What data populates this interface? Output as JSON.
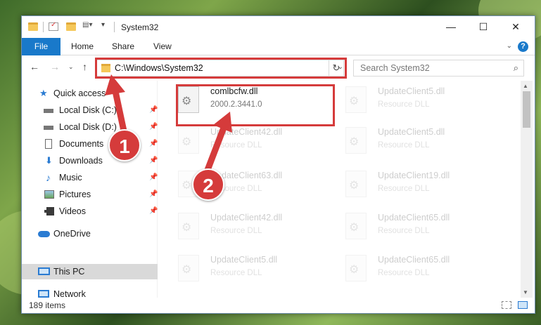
{
  "window": {
    "title": "System32",
    "controls": {
      "minimize": "—",
      "maximize": "☐",
      "close": "✕"
    }
  },
  "ribbon": {
    "file_tab": "File",
    "tabs": [
      "Home",
      "Share",
      "View"
    ],
    "help": "?"
  },
  "address": {
    "path": "C:\\Windows\\System32",
    "search_placeholder": "Search System32"
  },
  "nav": {
    "items": [
      {
        "label": "Quick access",
        "icon": "star-icon",
        "pinned": false
      },
      {
        "label": "Local Disk (C:)",
        "icon": "drive-icon",
        "pinned": true
      },
      {
        "label": "Local Disk (D:)",
        "icon": "drive-icon",
        "pinned": true
      },
      {
        "label": "Documents",
        "icon": "documents-icon",
        "pinned": true
      },
      {
        "label": "Downloads",
        "icon": "download-icon",
        "pinned": true
      },
      {
        "label": "Music",
        "icon": "music-icon",
        "pinned": true
      },
      {
        "label": "Pictures",
        "icon": "pictures-icon",
        "pinned": true
      },
      {
        "label": "Videos",
        "icon": "videos-icon",
        "pinned": true
      },
      {
        "label": "OneDrive",
        "icon": "cloud-icon",
        "pinned": false
      },
      {
        "label": "This PC",
        "icon": "computer-icon",
        "pinned": false,
        "selected": true
      },
      {
        "label": "Network",
        "icon": "network-icon",
        "pinned": false
      }
    ]
  },
  "files": {
    "highlighted": {
      "name": "comlbcfw.dll",
      "version": "2000.2.3441.0"
    },
    "background_col1": [
      {
        "name": "UpdateClient42.dll",
        "type": "Resource DLL"
      },
      {
        "name": "UpdateClient63.dll",
        "type": "Resource DLL"
      },
      {
        "name": "UpdateClient42.dll",
        "type": "Resource DLL"
      },
      {
        "name": "UpdateClient5.dll",
        "type": "Resource DLL"
      }
    ],
    "background_col2": [
      {
        "name": "UpdateClient5.dll",
        "type": "Resource DLL"
      },
      {
        "name": "UpdateClient5.dll",
        "type": "Resource DLL"
      },
      {
        "name": "UpdateClient19.dll",
        "type": "Resource DLL"
      },
      {
        "name": "UpdateClient65.dll",
        "type": "Resource DLL"
      },
      {
        "name": "UpdateClient65.dll",
        "type": "Resource DLL"
      }
    ]
  },
  "status": {
    "item_count": "189 items"
  },
  "annotations": {
    "step1": "1",
    "step2": "2",
    "color": "#d53b3b"
  }
}
